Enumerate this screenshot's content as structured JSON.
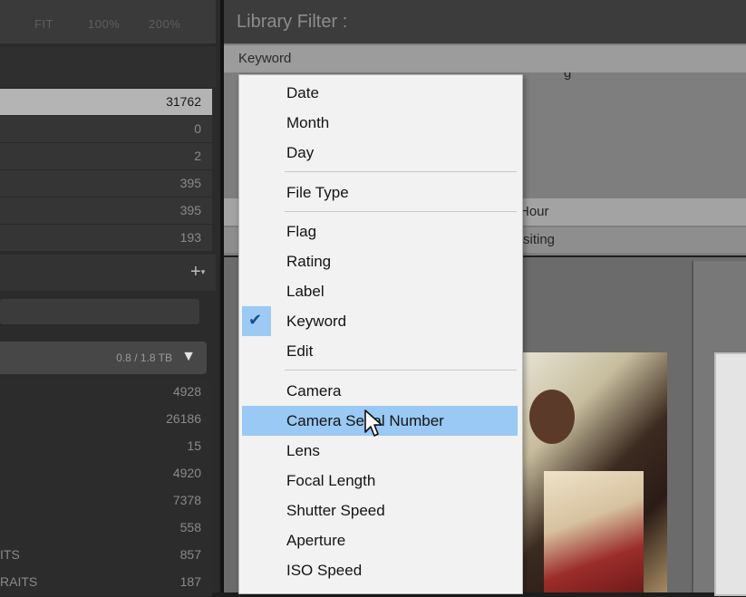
{
  "zoom": {
    "fit": "FIT",
    "p100": "100%",
    "p200": "200%"
  },
  "catalog": {
    "counts": [
      "31762",
      "0",
      "2",
      "395",
      "395",
      "193"
    ]
  },
  "collections": {
    "drive_size": "0.8 / 1.8 TB"
  },
  "folders": [
    {
      "name": "",
      "count": "4928"
    },
    {
      "name": "",
      "count": "26186"
    },
    {
      "name": "",
      "count": "15"
    },
    {
      "name": "",
      "count": "4920"
    },
    {
      "name": "",
      "count": "7378"
    },
    {
      "name": "",
      "count": "558"
    },
    {
      "name": "ITS",
      "count": "857"
    },
    {
      "name": "RAITS",
      "count": "187"
    }
  ],
  "filter": {
    "title": "Library Filter :",
    "column": "Keyword",
    "partial_hour": "Hour",
    "partial_2": "siting",
    "partial_top": "g"
  },
  "menu": {
    "items": [
      "Date",
      "Month",
      "Day",
      "File Type",
      "Flag",
      "Rating",
      "Label",
      "Keyword",
      "Edit",
      "Camera",
      "Camera Serial Number",
      "Lens",
      "Focal Length",
      "Shutter Speed",
      "Aperture",
      "ISO Speed"
    ],
    "checked": "Keyword",
    "highlighted": "Camera Serial Number"
  },
  "colors": {
    "highlight": "#99c9f4",
    "menu_bg": "#f2f2f2",
    "panel_bg": "#2b2b2b"
  }
}
